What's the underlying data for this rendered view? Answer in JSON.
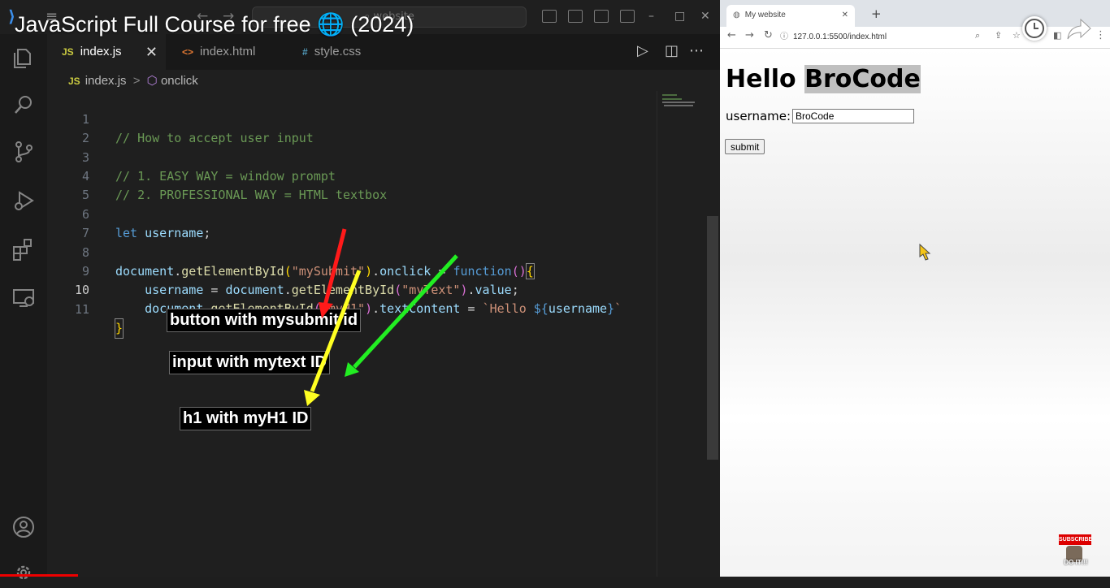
{
  "video": {
    "title": "JavaScript Full Course for free 🌐 (2024)"
  },
  "vscode": {
    "search_placeholder": "website",
    "tabs": [
      {
        "icon": "JS",
        "label": "index.js",
        "active": true
      },
      {
        "icon": "<>",
        "label": "index.html",
        "active": false
      },
      {
        "icon": "#",
        "label": "style.css",
        "active": false
      }
    ],
    "close_label": "✕",
    "breadcrumb": {
      "file_icon": "JS",
      "file": "index.js",
      "separator": ">",
      "symbol": "onclick"
    },
    "code_lines": [
      {
        "num": "1",
        "text": "// How to accept user input"
      },
      {
        "num": "2",
        "text": ""
      },
      {
        "num": "3",
        "text": "// 1. EASY WAY = window prompt"
      },
      {
        "num": "4",
        "text": "// 2. PROFESSIONAL WAY = HTML textbox"
      },
      {
        "num": "5",
        "text": ""
      },
      {
        "num": "6",
        "text": "let username;"
      },
      {
        "num": "7",
        "text": ""
      },
      {
        "num": "8",
        "text": "document.getElementById(\"mySubmit\").onclick = function(){"
      },
      {
        "num": "9",
        "text": "    username = document.getElementById(\"myText\").value;"
      },
      {
        "num": "10",
        "text": "    document.getElementById(\"myH1\").textContent = `Hello ${username}`"
      },
      {
        "num": "11",
        "text": "}"
      }
    ],
    "current_line": "10"
  },
  "annotations": {
    "callouts": [
      {
        "text": "button with mysubmit id",
        "arrow_color": "#ff1a1a"
      },
      {
        "text": "input with mytext ID",
        "arrow_color": "#22ee22"
      },
      {
        "text": "h1 with myH1 ID",
        "arrow_color": "#ffff22"
      }
    ]
  },
  "browser": {
    "tab_title": "My website",
    "new_tab": "+",
    "address": "127.0.0.1:5500/index.html",
    "page": {
      "h1_prefix": "Hello",
      "h1_name": "BroCode",
      "label": "username:",
      "input_value": "BroCode",
      "submit_label": "submit"
    }
  },
  "overlay": {
    "subscribe": "SUBSCRIBE",
    "mascot_caption": "DO IT!!!"
  }
}
